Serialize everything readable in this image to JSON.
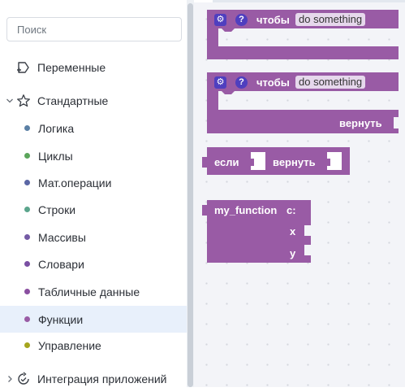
{
  "search": {
    "placeholder": "Поиск"
  },
  "sidebar": {
    "top_items": [
      {
        "label": "Переменные",
        "icon": "variable-icon"
      },
      {
        "label": "Стандартные",
        "icon": "star-icon",
        "expanded": true
      },
      {
        "label": "Интеграция приложений",
        "icon": "integration-icon"
      }
    ],
    "sub_items": [
      {
        "label": "Логика",
        "color": "#5b80a5"
      },
      {
        "label": "Циклы",
        "color": "#5ba55b"
      },
      {
        "label": "Мат.операции",
        "color": "#5b67a5"
      },
      {
        "label": "Строки",
        "color": "#5ba58c"
      },
      {
        "label": "Массивы",
        "color": "#745ba5"
      },
      {
        "label": "Словари",
        "color": "#7a4fa3"
      },
      {
        "label": "Табличные данные",
        "color": "#8a4fa0"
      },
      {
        "label": "Функции",
        "color": "#995ba5",
        "active": true
      },
      {
        "label": "Управление",
        "color": "#a5a51e"
      }
    ]
  },
  "blocks": {
    "color": "#995ba5",
    "procedure_no_return": {
      "keyword": "чтобы",
      "name": "do something",
      "gear_symbol": "⚙",
      "help_symbol": "?"
    },
    "procedure_return": {
      "keyword": "чтобы",
      "name": "do something",
      "return_label": "вернуть",
      "gear_symbol": "⚙",
      "help_symbol": "?"
    },
    "if_return": {
      "if_label": "если",
      "return_label": "вернуть"
    },
    "call_function": {
      "name": "my_function",
      "params_label": "с:",
      "params": [
        "x",
        "y"
      ]
    }
  }
}
